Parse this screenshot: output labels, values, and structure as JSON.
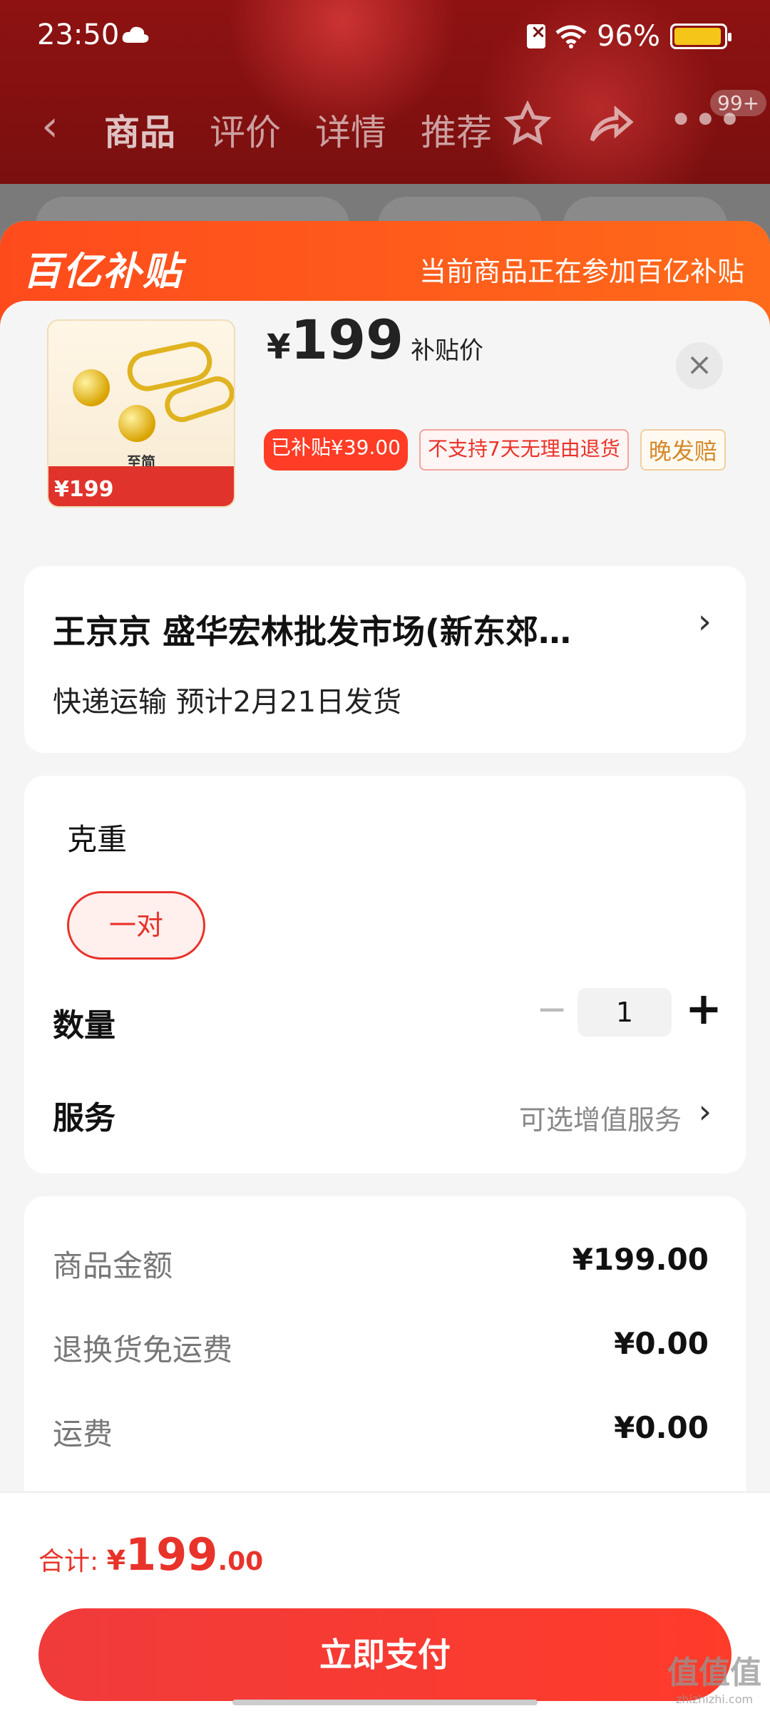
{
  "status_bar": {
    "time": "23:50",
    "battery": "96%",
    "battery_level": 0.96,
    "battery_color": "#f5c518"
  },
  "nav": {
    "back_icon": "chevron-left-icon",
    "tabs": [
      "商品",
      "评价",
      "详情",
      "推荐"
    ],
    "badge": "99+"
  },
  "banner": {
    "logo": "百亿补贴",
    "text": "当前商品正在参加百亿补贴"
  },
  "product": {
    "thumb": {
      "title": "至简",
      "price": "¥199"
    },
    "price_symbol": "¥",
    "price": "199",
    "price_label": "补贴价",
    "tags": [
      "已补贴¥39.00",
      "不支持7天无理由退货",
      "晚发赔"
    ]
  },
  "address": {
    "line1": "王京京  盛华宏林批发市场(新东郊…",
    "line2": "快递运输 预计2月21日发货"
  },
  "options": {
    "weight_title": "克重",
    "selected_option": "一对",
    "quantity_label": "数量",
    "quantity": "1",
    "service_label": "服务",
    "service_value": "可选增值服务"
  },
  "summary": {
    "rows": [
      {
        "label": "商品金额",
        "value": "¥199.00"
      },
      {
        "label": "退换货免运费",
        "value": "¥0.00"
      },
      {
        "label": "运费",
        "value": "¥0.00"
      }
    ]
  },
  "footer": {
    "total_label": "合计: ",
    "total_symbol": "¥",
    "total_int": "199",
    "total_dec": ".00",
    "pay_button": "立即支付"
  },
  "watermark": {
    "text": "值值值",
    "sub": "zhizhizhi.com"
  },
  "colors": {
    "accent": "#e8332a",
    "banner": "#ff5a1e",
    "pay_button": "#f03b3b"
  }
}
